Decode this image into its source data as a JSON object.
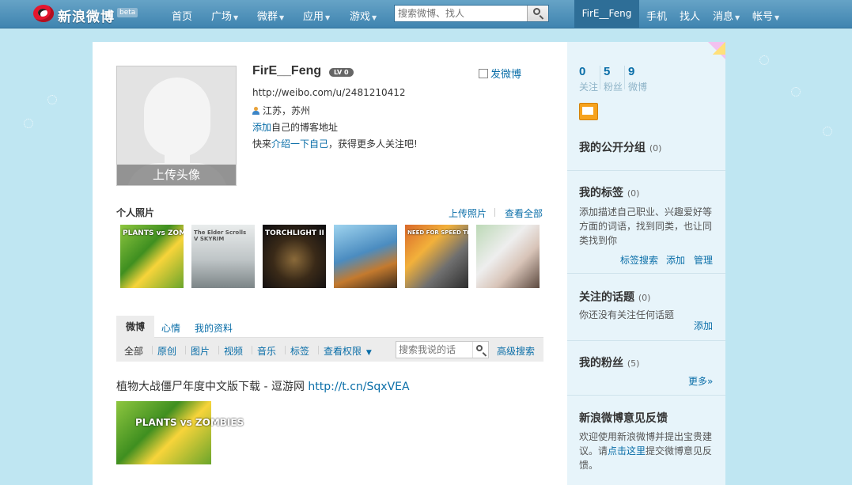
{
  "topbar": {
    "logo_text": "新浪微博",
    "beta": "beta",
    "nav": [
      {
        "label": "首页",
        "dropdown": false
      },
      {
        "label": "广场",
        "dropdown": true
      },
      {
        "label": "微群",
        "dropdown": true
      },
      {
        "label": "应用",
        "dropdown": true
      },
      {
        "label": "游戏",
        "dropdown": true
      }
    ],
    "search_placeholder": "搜索微博、找人",
    "user": "FirE__Feng",
    "right_nav": [
      {
        "label": "手机",
        "dropdown": false
      },
      {
        "label": "找人",
        "dropdown": false
      },
      {
        "label": "消息",
        "dropdown": true
      },
      {
        "label": "帐号",
        "dropdown": true
      }
    ]
  },
  "profile": {
    "upload_avatar": "上传头像",
    "name": "FirE__Feng",
    "level": "LV 0",
    "post_link": "发微博",
    "url": "http://weibo.com/u/2481210412",
    "location": "江苏，苏州",
    "blog_add": "添加",
    "blog_rest": "自己的博客地址",
    "intro_prefix": "快来",
    "intro_link": "介绍一下自己",
    "intro_suffix": "，获得更多人关注吧!"
  },
  "photos": {
    "title": "个人照片",
    "upload": "上传照片",
    "view_all": "查看全部",
    "items": [
      {
        "caption": "PLANTS vs ZOMBIES"
      },
      {
        "caption": "The Elder Scrolls V SKYRIM"
      },
      {
        "caption": "TORCHLIGHT II"
      },
      {
        "caption": ""
      },
      {
        "caption": "NEED FOR SPEED THE RUN"
      },
      {
        "caption": ""
      }
    ]
  },
  "feed": {
    "tabs": [
      "微博",
      "心情",
      "我的资料"
    ],
    "filters": [
      "全部",
      "原创",
      "图片",
      "视频",
      "音乐",
      "标签",
      "查看权限"
    ],
    "search_placeholder": "搜索我说的话",
    "advanced": "高级搜索",
    "post_text": "植物大战僵尸年度中文版下载 - 逗游网",
    "post_url": "http://t.cn/SqxVEA",
    "post_image_caption": "PLANTS vs ZOMBIES"
  },
  "sidebar": {
    "stats": [
      {
        "num": "0",
        "label": "关注"
      },
      {
        "num": "5",
        "label": "粉丝"
      },
      {
        "num": "9",
        "label": "微博"
      }
    ],
    "public_groups": {
      "title": "我的公开分组",
      "count": "(0)"
    },
    "tags": {
      "title": "我的标签",
      "count": "(0)",
      "desc": "添加描述自己职业、兴趣爱好等方面的词语，找到同类，也让同类找到你",
      "links": [
        "标签搜索",
        "添加",
        "管理"
      ]
    },
    "topics": {
      "title": "关注的话题",
      "count": "(0)",
      "desc": "你还没有关注任何话题",
      "add": "添加"
    },
    "fans": {
      "title": "我的粉丝",
      "count": "(5)",
      "more": "更多»"
    },
    "feedback": {
      "title": "新浪微博意见反馈",
      "pre": "欢迎使用新浪微博并提出宝贵建议。请",
      "link": "点击这里",
      "post": "提交微博意见反馈。"
    }
  }
}
